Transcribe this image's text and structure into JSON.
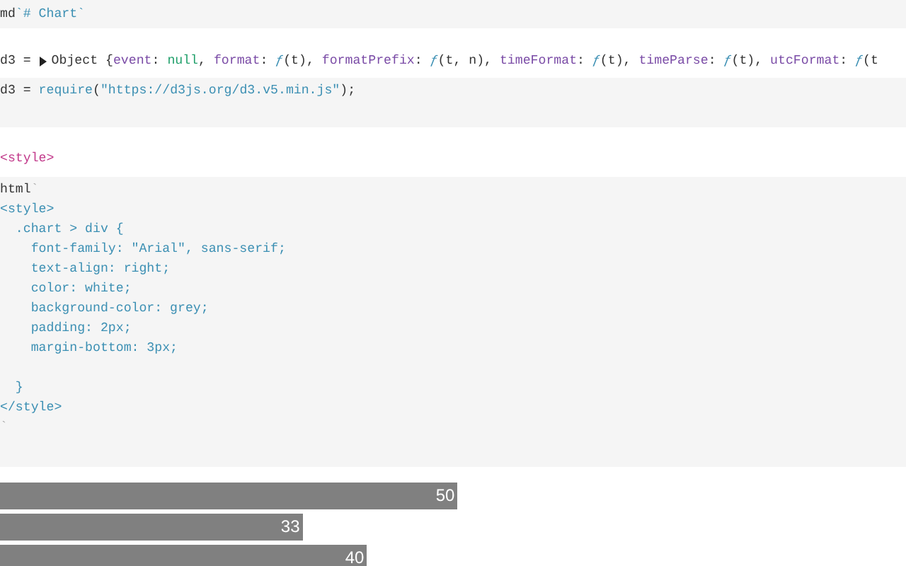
{
  "cells": [
    {
      "kind": "input",
      "lines": [
        {
          "tokens": [
            {
              "text": "md",
              "kind": "plain"
            },
            {
              "text": "`# Chart`",
              "kind": "accent"
            }
          ]
        }
      ]
    },
    {
      "kind": "output",
      "lines": [
        {
          "tokens": [
            {
              "text": "d3 = ",
              "kind": "plain"
            },
            {
              "kind": "caret"
            },
            {
              "text": "Object {",
              "kind": "plain"
            },
            {
              "text": "event",
              "kind": "key"
            },
            {
              "text": ": ",
              "kind": "plain"
            },
            {
              "text": "null",
              "kind": "null"
            },
            {
              "text": ", ",
              "kind": "plain"
            },
            {
              "text": "format",
              "kind": "key"
            },
            {
              "text": ": ",
              "kind": "plain"
            },
            {
              "text": "ƒ",
              "kind": "fn"
            },
            {
              "text": "(t), ",
              "kind": "plain"
            },
            {
              "text": "formatPrefix",
              "kind": "key"
            },
            {
              "text": ": ",
              "kind": "plain"
            },
            {
              "text": "ƒ",
              "kind": "fn"
            },
            {
              "text": "(t, n), ",
              "kind": "plain"
            },
            {
              "text": "timeFormat",
              "kind": "key"
            },
            {
              "text": ": ",
              "kind": "plain"
            },
            {
              "text": "ƒ",
              "kind": "fn"
            },
            {
              "text": "(t), ",
              "kind": "plain"
            },
            {
              "text": "timeParse",
              "kind": "key"
            },
            {
              "text": ": ",
              "kind": "plain"
            },
            {
              "text": "ƒ",
              "kind": "fn"
            },
            {
              "text": "(t), ",
              "kind": "plain"
            },
            {
              "text": "utcFormat",
              "kind": "key"
            },
            {
              "text": ": ",
              "kind": "plain"
            },
            {
              "text": "ƒ",
              "kind": "fn"
            },
            {
              "text": "(t",
              "kind": "plain"
            }
          ]
        }
      ]
    },
    {
      "kind": "input",
      "lines": [
        {
          "tokens": [
            {
              "text": "d3 = ",
              "kind": "plain"
            },
            {
              "text": "require",
              "kind": "accent"
            },
            {
              "text": "(",
              "kind": "plain"
            },
            {
              "text": "\"https://d3js.org/d3.v5.min.js\"",
              "kind": "accent"
            },
            {
              "text": ");",
              "kind": "plain"
            }
          ]
        }
      ]
    },
    {
      "kind": "output",
      "lines": [
        {
          "tokens": [
            {
              "text": "<style>",
              "kind": "tag"
            }
          ]
        }
      ]
    },
    {
      "kind": "input",
      "lines": [
        {
          "tokens": [
            {
              "text": "html",
              "kind": "plain"
            },
            {
              "text": "`",
              "kind": "punct"
            }
          ]
        },
        {
          "tokens": [
            {
              "text": "<style>",
              "kind": "accent"
            }
          ]
        },
        {
          "tokens": [
            {
              "text": "  .chart > div {",
              "kind": "accent"
            }
          ]
        },
        {
          "tokens": [
            {
              "text": "    font-family: \"Arial\", sans-serif;",
              "kind": "accent"
            }
          ]
        },
        {
          "tokens": [
            {
              "text": "    text-align: right;",
              "kind": "accent"
            }
          ]
        },
        {
          "tokens": [
            {
              "text": "    color: white;",
              "kind": "accent"
            }
          ]
        },
        {
          "tokens": [
            {
              "text": "    background-color: grey;",
              "kind": "accent"
            }
          ]
        },
        {
          "tokens": [
            {
              "text": "    padding: 2px;",
              "kind": "accent"
            }
          ]
        },
        {
          "tokens": [
            {
              "text": "    margin-bottom: 3px;",
              "kind": "accent"
            }
          ]
        },
        {
          "blank_before": true,
          "tokens": [
            {
              "text": "  }",
              "kind": "accent"
            }
          ]
        },
        {
          "tokens": [
            {
              "text": "</style>",
              "kind": "accent"
            }
          ]
        },
        {
          "tokens": [
            {
              "text": "`",
              "kind": "punct"
            }
          ]
        }
      ]
    },
    {
      "kind": "bars",
      "bars": [
        {
          "label": "50",
          "level": 0.505
        },
        {
          "label": "33",
          "level": 0.334
        },
        {
          "label": "40",
          "level": 0.405
        }
      ]
    }
  ]
}
